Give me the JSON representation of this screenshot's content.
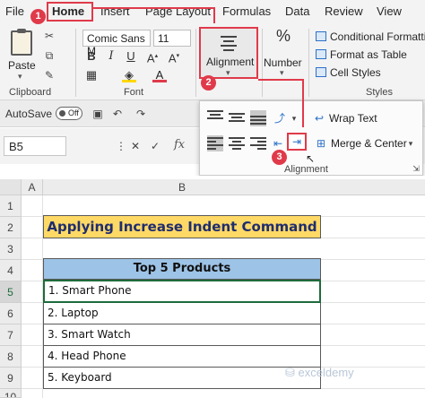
{
  "tabs": [
    "File",
    "Home",
    "Insert",
    "Page Layout",
    "Formulas",
    "Data",
    "Review",
    "View"
  ],
  "ribbon": {
    "clipboard": {
      "paste_label": "Paste",
      "group_label": "Clipboard"
    },
    "font": {
      "font_name": "Comic Sans M",
      "font_size": "11",
      "group_label": "Font"
    },
    "alignment_label": "Alignment",
    "number_label": "Number",
    "styles": {
      "items": [
        "Conditional Formatting",
        "Format as Table",
        "Cell Styles"
      ],
      "group_label": "Styles"
    }
  },
  "qat": {
    "autosave_label": "AutoSave",
    "toggle_label": "Off"
  },
  "formula_bar": {
    "name_box": "B5",
    "fx": "fx"
  },
  "alignment_popup": {
    "wrap_text": "Wrap Text",
    "merge_center": "Merge & Center",
    "group_label": "Alignment"
  },
  "callouts": [
    "1",
    "2",
    "3"
  ],
  "columns": [
    "A",
    "B"
  ],
  "rows": [
    "1",
    "2",
    "3",
    "4",
    "5",
    "6",
    "7",
    "8",
    "9",
    "10"
  ],
  "sheet": {
    "title": "Applying Increase Indent Command",
    "table_header": "Top 5 Products",
    "products": [
      "1. Smart Phone",
      "2. Laptop",
      "3. Smart Watch",
      "4. Head Phone",
      "5. Keyboard"
    ]
  },
  "watermark": "exceldemy",
  "colors": {
    "accent_red": "#e03a4a",
    "title_fill": "#ffd966",
    "header_fill": "#9dc3e6",
    "selection_green": "#1e6b3c"
  }
}
